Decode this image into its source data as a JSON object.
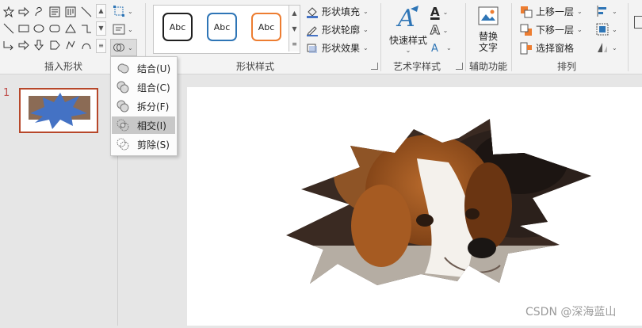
{
  "ribbon": {
    "groups": {
      "insert_shapes": "插入形状",
      "shape_styles": "形状样式",
      "wordart_styles": "艺术字样式",
      "accessibility": "辅助功能",
      "arrange": "排列"
    },
    "style_samples": [
      "Abc",
      "Abc",
      "Abc"
    ],
    "style_colors": [
      "#1f1f1f",
      "#2e75b6",
      "#ed7d31"
    ],
    "shape_fill": "形状填充",
    "shape_outline": "形状轮廓",
    "shape_effects": "形状效果",
    "quick_styles": [
      "快速样式"
    ],
    "alt_text": [
      "替换",
      "文字"
    ],
    "bring_forward": "上移一层",
    "send_backward": "下移一层",
    "selection_pane": "选择窗格",
    "text_fill_letter": "A",
    "text_outline_letter": "A"
  },
  "merge_menu": {
    "items": [
      {
        "label": "结合(U)",
        "icon": "union-icon"
      },
      {
        "label": "组合(C)",
        "icon": "combine-icon"
      },
      {
        "label": "拆分(F)",
        "icon": "fragment-icon"
      },
      {
        "label": "相交(I)",
        "icon": "intersect-icon"
      },
      {
        "label": "剪除(S)",
        "icon": "subtract-icon"
      }
    ],
    "highlighted": "相交(I)"
  },
  "slides_panel": {
    "slide_number": "1"
  },
  "watermark": "CSDN @深海蓝山",
  "colors": {
    "accent": "#b7472a",
    "wordart_blue": "#2e75b6",
    "star_blue": "#4472c4"
  }
}
